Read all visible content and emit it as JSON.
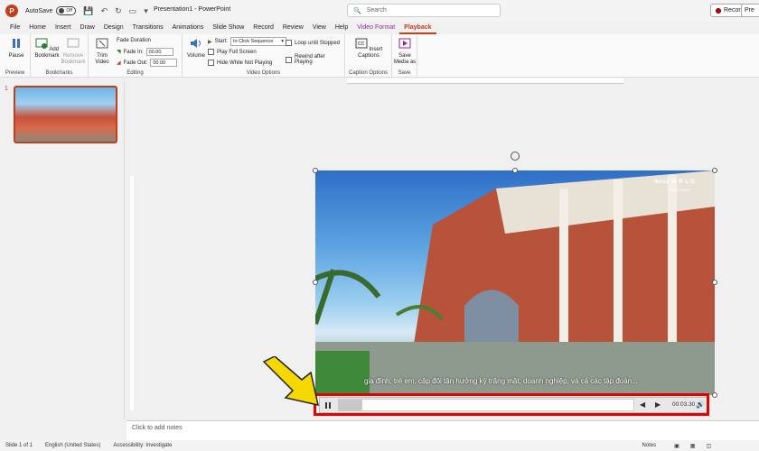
{
  "titlebar": {
    "logo_letter": "P",
    "autosave_label": "AutoSave",
    "autosave_state": "Off",
    "document_title": "Presentation1 - PowerPoint",
    "search_placeholder": "Search",
    "record_label": "Record",
    "present_label": "Pre"
  },
  "tabs": [
    "File",
    "Home",
    "Insert",
    "Draw",
    "Design",
    "Transitions",
    "Animations",
    "Slide Show",
    "Record",
    "Review",
    "View",
    "Help",
    "Video Format",
    "Playback"
  ],
  "ribbon": {
    "preview": {
      "pause_label": "Pause",
      "group_label": "Preview"
    },
    "bookmarks": {
      "add_label": "Add Bookmark",
      "remove_label": "Remove Bookmark",
      "group_label": "Bookmarks"
    },
    "editing": {
      "trim_label": "Trim Video",
      "fade_duration_label": "Fade Duration",
      "fade_in_label": "Fade In:",
      "fade_in_value": "00.00",
      "fade_out_label": "Fade Out:",
      "fade_out_value": "00.00",
      "group_label": "Editing"
    },
    "video_options": {
      "volume_label": "Volume",
      "start_label": "Start:",
      "start_value": "In Click Sequence",
      "play_full_screen": "Play Full Screen",
      "hide_while_not_playing": "Hide While Not Playing",
      "loop_until_stopped": "Loop until Stopped",
      "rewind_after_playing": "Rewind after Playing",
      "group_label": "Video Options"
    },
    "caption_options": {
      "insert_captions_label": "Insert Captions",
      "group_label": "Caption Options"
    },
    "save": {
      "save_media_label": "Save Media as",
      "group_label": "Save"
    }
  },
  "slides": {
    "slide_number": "1"
  },
  "video": {
    "subtitle": "gia đình, trẻ em, cặp đôi tận hưởng kỳ trăng mật, doanh nghiệp, và cả các tập đoàn...",
    "logo_text": "Nova W  R  L  D",
    "logo_sub": "PHAN THIET",
    "time": "00:03.30",
    "progress_fraction": 0.08
  },
  "notes": {
    "placeholder": "Click to add notes"
  },
  "statusbar": {
    "slide_info": "Slide 1 of 1",
    "language": "English (United States)",
    "accessibility": "Accessibility: Investigate",
    "notes_label": "Notes"
  },
  "colors": {
    "accent": "#c43e1c",
    "highlight": "#e60000",
    "arrow": "#f5d800"
  }
}
